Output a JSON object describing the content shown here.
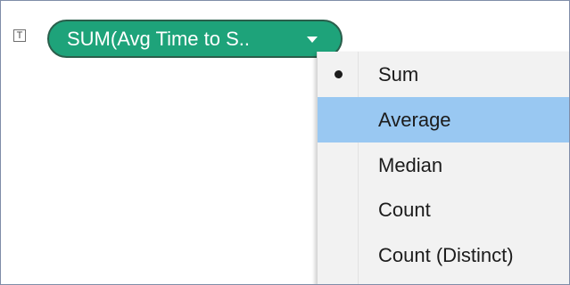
{
  "shelf": {
    "type_icon_glyph": "T",
    "pill_label": "SUM(Avg Time to S..",
    "pill_color": "#1ea37a"
  },
  "menu": {
    "items": [
      {
        "label": "Sum",
        "selected": true,
        "highlighted": false
      },
      {
        "label": "Average",
        "selected": false,
        "highlighted": true
      },
      {
        "label": "Median",
        "selected": false,
        "highlighted": false
      },
      {
        "label": "Count",
        "selected": false,
        "highlighted": false
      },
      {
        "label": "Count (Distinct)",
        "selected": false,
        "highlighted": false
      }
    ],
    "highlight_color": "#99c8f2"
  }
}
